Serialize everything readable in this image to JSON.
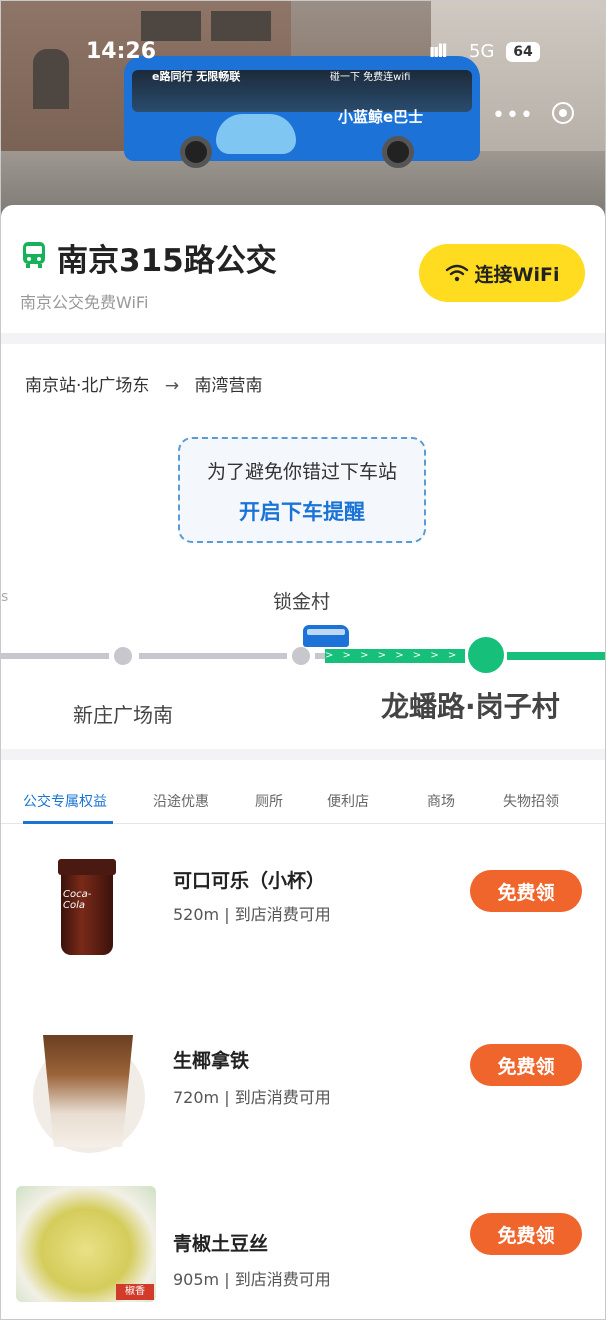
{
  "status_bar": {
    "time": "14:26",
    "signal": "ııll",
    "network": "5G",
    "battery": "64"
  },
  "hero": {
    "bus_slogan_left": "e路同行 无限畅联",
    "bus_slogan_right": "碰一下 免费连wifi",
    "bus_brand": "小蓝鲸e巴士",
    "dots": "•••"
  },
  "header": {
    "title": "南京315路公交",
    "subtitle": "南京公交免费WiFi",
    "wifi_button": "连接WiFi"
  },
  "route": {
    "from": "南京站·北广场东",
    "arrow": "→",
    "to": "南湾营南"
  },
  "reminder": {
    "line1": "为了避免你错过下车站",
    "action": "开启下车提醒"
  },
  "stops": {
    "upper": "锁金村",
    "lower_left": "新庄广场南",
    "current": "龙蟠路·岗子村",
    "dash_arrows": "> > > > > > > > > > >",
    "edge_glyph": "s"
  },
  "tabs": [
    {
      "label": "公交专属权益",
      "active": true
    },
    {
      "label": "沿途优惠",
      "active": false
    },
    {
      "label": "厕所",
      "active": false
    },
    {
      "label": "便利店",
      "active": false
    },
    {
      "label": "商场",
      "active": false
    },
    {
      "label": "失物招领",
      "active": false
    }
  ],
  "offers": [
    {
      "title": "可口可乐（小杯）",
      "meta": "520m | 到店消费可用",
      "button": "免费领",
      "img_label": "Coca-Cola"
    },
    {
      "title": "生椰拿铁",
      "meta": "720m | 到店消费可用",
      "button": "免费领"
    },
    {
      "title": "青椒土豆丝",
      "meta": "905m | 到店消费可用",
      "button": "免费领",
      "img_label": "椒香"
    }
  ],
  "colors": {
    "accent_blue": "#1a74d6",
    "wifi_yellow": "#ffdc1f",
    "claim_orange": "#f0652c",
    "line_green": "#17c07a"
  }
}
